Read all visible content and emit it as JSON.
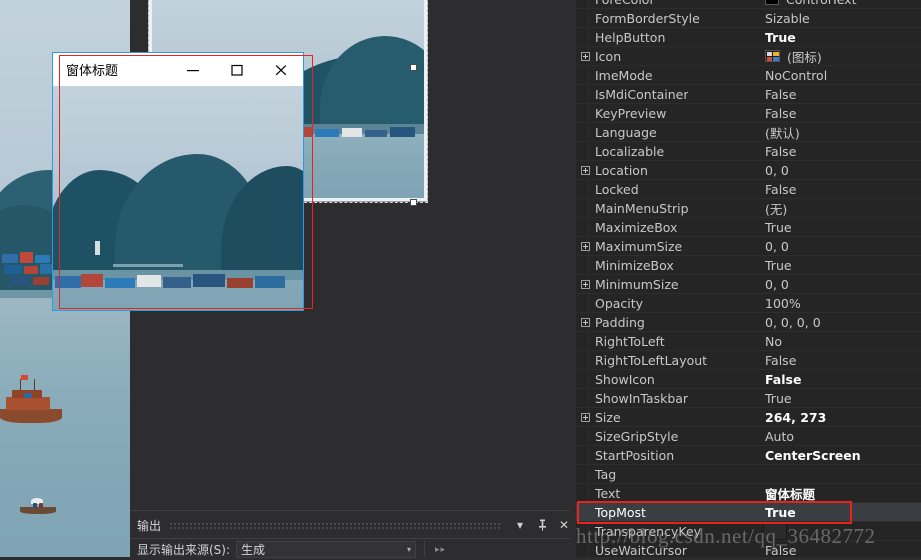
{
  "form_window": {
    "title": "窗体标题",
    "minimize_label": "—",
    "maximize_label": "□",
    "close_label": "✕"
  },
  "output_panel": {
    "title": "输出",
    "dropdown_label": "▾",
    "pin_label": "⊥",
    "close_label": "✕",
    "source_label": "显示输出来源(S):",
    "source_value": "生成",
    "source_caret": "▾",
    "overflow_label": "▸▸"
  },
  "property_grid": {
    "rows": [
      {
        "name": "ForeColor",
        "value": "ControlText",
        "expandable": false,
        "bold": false,
        "swatch": true,
        "clipped": true
      },
      {
        "name": "FormBorderStyle",
        "value": "Sizable",
        "expandable": false,
        "bold": false
      },
      {
        "name": "HelpButton",
        "value": "True",
        "expandable": false,
        "bold": true
      },
      {
        "name": "Icon",
        "value": "(图标)",
        "expandable": true,
        "bold": false,
        "icon": true
      },
      {
        "name": "ImeMode",
        "value": "NoControl",
        "expandable": false,
        "bold": false
      },
      {
        "name": "IsMdiContainer",
        "value": "False",
        "expandable": false,
        "bold": false
      },
      {
        "name": "KeyPreview",
        "value": "False",
        "expandable": false,
        "bold": false
      },
      {
        "name": "Language",
        "value": "(默认)",
        "expandable": false,
        "bold": false
      },
      {
        "name": "Localizable",
        "value": "False",
        "expandable": false,
        "bold": false
      },
      {
        "name": "Location",
        "value": "0, 0",
        "expandable": true,
        "bold": false
      },
      {
        "name": "Locked",
        "value": "False",
        "expandable": false,
        "bold": false
      },
      {
        "name": "MainMenuStrip",
        "value": "(无)",
        "expandable": false,
        "bold": false
      },
      {
        "name": "MaximizeBox",
        "value": "True",
        "expandable": false,
        "bold": false
      },
      {
        "name": "MaximumSize",
        "value": "0, 0",
        "expandable": true,
        "bold": false
      },
      {
        "name": "MinimizeBox",
        "value": "True",
        "expandable": false,
        "bold": false
      },
      {
        "name": "MinimumSize",
        "value": "0, 0",
        "expandable": true,
        "bold": false
      },
      {
        "name": "Opacity",
        "value": "100%",
        "expandable": false,
        "bold": false
      },
      {
        "name": "Padding",
        "value": "0, 0, 0, 0",
        "expandable": true,
        "bold": false
      },
      {
        "name": "RightToLeft",
        "value": "No",
        "expandable": false,
        "bold": false
      },
      {
        "name": "RightToLeftLayout",
        "value": "False",
        "expandable": false,
        "bold": false
      },
      {
        "name": "ShowIcon",
        "value": "False",
        "expandable": false,
        "bold": true
      },
      {
        "name": "ShowInTaskbar",
        "value": "True",
        "expandable": false,
        "bold": false
      },
      {
        "name": "Size",
        "value": "264, 273",
        "expandable": true,
        "bold": true
      },
      {
        "name": "SizeGripStyle",
        "value": "Auto",
        "expandable": false,
        "bold": false
      },
      {
        "name": "StartPosition",
        "value": "CenterScreen",
        "expandable": false,
        "bold": true
      },
      {
        "name": "Tag",
        "value": "",
        "expandable": false,
        "bold": false
      },
      {
        "name": "Text",
        "value": "窗体标题",
        "expandable": false,
        "bold": true
      },
      {
        "name": "TopMost",
        "value": "True",
        "expandable": false,
        "bold": true,
        "selected": true
      },
      {
        "name": "TransparencyKey",
        "value": "",
        "expandable": false,
        "bold": false
      },
      {
        "name": "UseWaitCursor",
        "value": "False",
        "expandable": false,
        "bold": false
      }
    ]
  },
  "watermark": {
    "text": "http://blog.csdn.net/qq_36482772"
  },
  "colors": {
    "highlight_red": "#e8231c",
    "panel_bg": "#252526",
    "ide_bg": "#2d2d30",
    "selection_blue": "#2f9ae0"
  }
}
